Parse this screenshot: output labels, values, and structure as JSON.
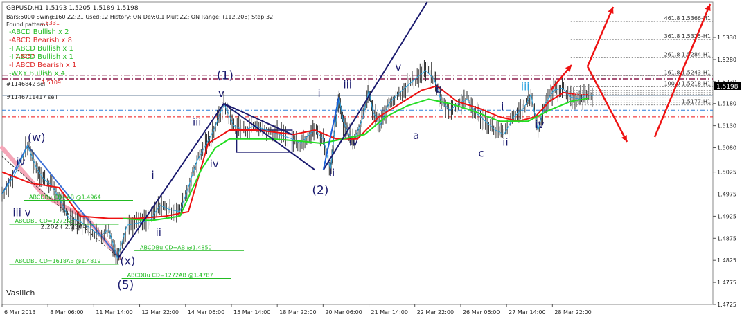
{
  "window": {
    "header": "GBPUSD,H1  1.5193 1.5205 1.5189 1.5198",
    "info_line": "Bars:5000  Swing:160  ZZ:21  Used:12  History: ON Dev:0.1  MultiZZ: ON  Range: (112,208)  Step:32"
  },
  "patterns": {
    "title": "Found patterns:",
    "items": [
      {
        "text": "-ABCD Bullish x 2",
        "color": "#22bb22"
      },
      {
        "text": "-ABCD Bearish x 8",
        "color": "#dd2222"
      },
      {
        "text": "-I ABCD Bullish x 1",
        "color": "#22bb22"
      },
      {
        "text": "-I ABCD Bullish x 1",
        "color": "#22bb22"
      },
      {
        "text": "-I ABCD Bearish x 1",
        "color": "#dd2222"
      },
      {
        "text": "-WXY Bullish x 4",
        "color": "#22bb22"
      }
    ],
    "overlays": [
      {
        "text": "1.5331",
        "color": "#dd2222"
      },
      {
        "text": "1.5257",
        "color": "#dd2222"
      },
      {
        "text": "#1146842 sell",
        "color": "#222222"
      },
      {
        "text": "1.5109",
        "color": "#dd2222"
      },
      {
        "text": "#1146711417 sell",
        "color": "#222222"
      }
    ]
  },
  "signature": "Vasilich",
  "current_price": "1.5198",
  "colors": {
    "price_bg": "#000000",
    "candle": "#333333",
    "ma_red": "#ee1111",
    "ma_green": "#22dd22",
    "wave_navy": "#1a1a6e",
    "thin_blue": "#29a3e0",
    "fib_red": "#ee1111",
    "level_line": "#8b1a4a",
    "dash_blue": "#2a7fd8"
  },
  "chart_data": {
    "type": "line",
    "symbol": "GBPUSD",
    "timeframe": "H1",
    "ylim": [
      1.4725,
      1.541
    ],
    "y_ticks": [
      "1.5330",
      "1.5280",
      "1.5230",
      "1.5180",
      "1.5130",
      "1.5080",
      "1.5025",
      "1.4975",
      "1.4925",
      "1.4875",
      "1.4825",
      "1.4775",
      "1.4725"
    ],
    "y_tick_values": [
      1.533,
      1.528,
      1.523,
      1.518,
      1.513,
      1.508,
      1.5025,
      1.4975,
      1.4925,
      1.4875,
      1.4825,
      1.4775,
      1.4725
    ],
    "x_ticks": [
      "6 Mar 2013",
      "8 Mar 06:00",
      "11 Mar 14:00",
      "12 Mar 22:00",
      "14 Mar 06:00",
      "15 Mar 14:00",
      "18 Mar 22:00",
      "20 Mar 06:00",
      "21 Mar 14:00",
      "22 Mar 22:00",
      "26 Mar 06:00",
      "27 Mar 14:00",
      "28 Mar 22:00"
    ],
    "x_tick_pos": [
      0.0,
      0.0645,
      0.129,
      0.1935,
      0.2581,
      0.3226,
      0.3871,
      0.4516,
      0.5161,
      0.5806,
      0.6452,
      0.7097,
      0.7742
    ],
    "price_path": [
      [
        0.0,
        1.4975
      ],
      [
        0.018,
        1.502
      ],
      [
        0.036,
        1.5085
      ],
      [
        0.048,
        1.5035
      ],
      [
        0.058,
        1.501
      ],
      [
        0.07,
        1.4995
      ],
      [
        0.082,
        1.496
      ],
      [
        0.094,
        1.492
      ],
      [
        0.108,
        1.4915
      ],
      [
        0.122,
        1.49
      ],
      [
        0.138,
        1.488
      ],
      [
        0.15,
        1.4895
      ],
      [
        0.162,
        1.483
      ],
      [
        0.176,
        1.4905
      ],
      [
        0.192,
        1.491
      ],
      [
        0.208,
        1.4915
      ],
      [
        0.222,
        1.495
      ],
      [
        0.236,
        1.494
      ],
      [
        0.25,
        1.4935
      ],
      [
        0.262,
        1.499
      ],
      [
        0.274,
        1.505
      ],
      [
        0.286,
        1.5085
      ],
      [
        0.298,
        1.512
      ],
      [
        0.312,
        1.518
      ],
      [
        0.326,
        1.513
      ],
      [
        0.34,
        1.512
      ],
      [
        0.356,
        1.513
      ],
      [
        0.372,
        1.512
      ],
      [
        0.39,
        1.511
      ],
      [
        0.408,
        1.51
      ],
      [
        0.42,
        1.509
      ],
      [
        0.432,
        1.511
      ],
      [
        0.44,
        1.512
      ],
      [
        0.452,
        1.51
      ],
      [
        0.462,
        1.503
      ],
      [
        0.468,
        1.512
      ],
      [
        0.474,
        1.5195
      ],
      [
        0.48,
        1.514
      ],
      [
        0.488,
        1.511
      ],
      [
        0.496,
        1.51
      ],
      [
        0.508,
        1.515
      ],
      [
        0.516,
        1.521
      ],
      [
        0.522,
        1.516
      ],
      [
        0.532,
        1.513
      ],
      [
        0.544,
        1.518
      ],
      [
        0.556,
        1.52
      ],
      [
        0.57,
        1.522
      ],
      [
        0.584,
        1.524
      ],
      [
        0.596,
        1.5255
      ],
      [
        0.608,
        1.5235
      ],
      [
        0.618,
        1.5185
      ],
      [
        0.63,
        1.5165
      ],
      [
        0.642,
        1.518
      ],
      [
        0.654,
        1.519
      ],
      [
        0.666,
        1.516
      ],
      [
        0.68,
        1.514
      ],
      [
        0.694,
        1.512
      ],
      [
        0.706,
        1.511
      ],
      [
        0.72,
        1.515
      ],
      [
        0.734,
        1.517
      ],
      [
        0.744,
        1.52
      ],
      [
        0.754,
        1.512
      ],
      [
        0.764,
        1.518
      ],
      [
        0.776,
        1.521
      ],
      [
        0.788,
        1.5215
      ],
      [
        0.8,
        1.5195
      ],
      [
        0.812,
        1.519
      ],
      [
        0.822,
        1.52
      ],
      [
        0.832,
        1.5198
      ]
    ],
    "ma_red": [
      [
        0.0,
        1.5025
      ],
      [
        0.04,
        1.5
      ],
      [
        0.08,
        1.499
      ],
      [
        0.11,
        1.4925
      ],
      [
        0.15,
        1.492
      ],
      [
        0.19,
        1.492
      ],
      [
        0.23,
        1.4925
      ],
      [
        0.262,
        1.4935
      ],
      [
        0.29,
        1.509
      ],
      [
        0.32,
        1.512
      ],
      [
        0.36,
        1.512
      ],
      [
        0.41,
        1.511
      ],
      [
        0.44,
        1.512
      ],
      [
        0.47,
        1.51
      ],
      [
        0.5,
        1.51
      ],
      [
        0.53,
        1.515
      ],
      [
        0.56,
        1.518
      ],
      [
        0.59,
        1.521
      ],
      [
        0.612,
        1.522
      ],
      [
        0.64,
        1.5185
      ],
      [
        0.67,
        1.517
      ],
      [
        0.7,
        1.515
      ],
      [
        0.726,
        1.514
      ],
      [
        0.75,
        1.515
      ],
      [
        0.77,
        1.5185
      ],
      [
        0.79,
        1.5205
      ],
      [
        0.81,
        1.52
      ],
      [
        0.825,
        1.52
      ]
    ],
    "ma_green": [
      [
        0.17,
        1.492
      ],
      [
        0.21,
        1.4915
      ],
      [
        0.25,
        1.4925
      ],
      [
        0.28,
        1.503
      ],
      [
        0.3,
        1.508
      ],
      [
        0.32,
        1.51
      ],
      [
        0.35,
        1.51
      ],
      [
        0.38,
        1.51
      ],
      [
        0.42,
        1.5095
      ],
      [
        0.45,
        1.509
      ],
      [
        0.48,
        1.51
      ],
      [
        0.51,
        1.511
      ],
      [
        0.54,
        1.515
      ],
      [
        0.57,
        1.5175
      ],
      [
        0.6,
        1.519
      ],
      [
        0.63,
        1.518
      ],
      [
        0.66,
        1.5165
      ],
      [
        0.7,
        1.514
      ],
      [
        0.74,
        1.514
      ],
      [
        0.77,
        1.5165
      ],
      [
        0.8,
        1.5185
      ],
      [
        0.825,
        1.5192
      ]
    ],
    "wave_labels": [
      {
        "text": "(w)",
        "x": 0.036,
        "y": 1.5095,
        "color": "#1a1a6e",
        "size": 16
      },
      {
        "text": "iv",
        "x": 0.02,
        "y": 1.504,
        "color": "#1a1a6e",
        "size": 15
      },
      {
        "text": "iii v",
        "x": 0.015,
        "y": 1.4925,
        "color": "#1a1a6e",
        "size": 15
      },
      {
        "text": "(x)",
        "x": 0.166,
        "y": 1.4815,
        "color": "#1a1a6e",
        "size": 16
      },
      {
        "text": "(5)",
        "x": 0.162,
        "y": 1.476,
        "color": "#1a1a6e",
        "size": 17
      },
      {
        "text": "i",
        "x": 0.21,
        "y": 1.501,
        "color": "#1a1a6e",
        "size": 15
      },
      {
        "text": "ii",
        "x": 0.216,
        "y": 1.488,
        "color": "#1a1a6e",
        "size": 15
      },
      {
        "text": "iii",
        "x": 0.268,
        "y": 1.513,
        "color": "#1a1a6e",
        "size": 15
      },
      {
        "text": "iv",
        "x": 0.292,
        "y": 1.5035,
        "color": "#1a1a6e",
        "size": 15
      },
      {
        "text": "v",
        "x": 0.304,
        "y": 1.5195,
        "color": "#1a1a6e",
        "size": 15
      },
      {
        "text": "(1)",
        "x": 0.302,
        "y": 1.5235,
        "color": "#1a1a6e",
        "size": 17
      },
      {
        "text": "i",
        "x": 0.444,
        "y": 1.5195,
        "color": "#1a1a6e",
        "size": 15
      },
      {
        "text": "ii",
        "x": 0.46,
        "y": 1.5015,
        "color": "#1a1a6e",
        "size": 15
      },
      {
        "text": "(2)",
        "x": 0.436,
        "y": 1.4975,
        "color": "#1a1a6e",
        "size": 17
      },
      {
        "text": "iii",
        "x": 0.48,
        "y": 1.5215,
        "color": "#1a1a6e",
        "size": 15
      },
      {
        "text": "iv",
        "x": 0.488,
        "y": 1.5085,
        "color": "#1a1a6e",
        "size": 15
      },
      {
        "text": "v",
        "x": 0.553,
        "y": 1.5255,
        "color": "#1a1a6e",
        "size": 15
      },
      {
        "text": "a",
        "x": 0.578,
        "y": 1.51,
        "color": "#1a1a6e",
        "size": 15
      },
      {
        "text": "b",
        "x": 0.61,
        "y": 1.5205,
        "color": "#1a1a6e",
        "size": 15
      },
      {
        "text": "c",
        "x": 0.67,
        "y": 1.506,
        "color": "#1a1a6e",
        "size": 15
      },
      {
        "text": "i",
        "x": 0.702,
        "y": 1.5165,
        "color": "#1a1a6e",
        "size": 15
      },
      {
        "text": "ii",
        "x": 0.704,
        "y": 1.5085,
        "color": "#1a1a6e",
        "size": 15
      },
      {
        "text": "iii",
        "x": 0.73,
        "y": 1.521,
        "color": "#29a3e0",
        "size": 15
      },
      {
        "text": "iv",
        "x": 0.75,
        "y": 1.5125,
        "color": "#1a1a6e",
        "size": 15
      }
    ],
    "green_labels": [
      {
        "text": "ABCDBu CD=AB   @1.4964",
        "x": 0.038,
        "y": 1.4964
      },
      {
        "text": "ABCDBu CD=1272AB",
        "x": 0.018,
        "y": 1.491
      },
      {
        "text": "ABCDBu CD=AB   @1.4850",
        "x": 0.194,
        "y": 1.485
      },
      {
        "text": "ABCDBu CD=1618AB   @1.4819",
        "x": 0.018,
        "y": 1.4819
      },
      {
        "text": "ABCDBu CD=1272AB   @1.4787",
        "x": 0.176,
        "y": 1.4787
      }
    ],
    "ratio_label": {
      "text": "2.202 ( 2.236 )",
      "x": 0.054,
      "y": 1.4897
    },
    "fib_levels": [
      {
        "text": "461.8 1.5366-H1",
        "price": 1.5366
      },
      {
        "text": "361.8 1.5325-H1",
        "price": 1.5325
      },
      {
        "text": "261.8 1.5284-H1",
        "price": 1.5284
      },
      {
        "text": "161.8 1.5243-H1",
        "price": 1.5243
      },
      {
        "text": "100.0 1.5218-H1",
        "price": 1.5218
      },
      {
        "text": "1.5177-H1",
        "price": 1.5177
      }
    ]
  }
}
